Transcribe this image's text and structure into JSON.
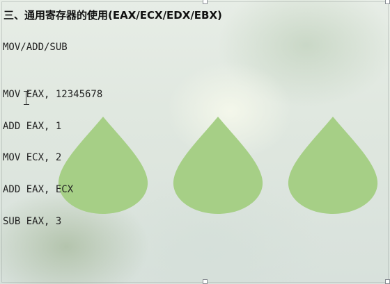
{
  "slide": {
    "title": "三、通用寄存器的使用(EAX/ECX/EDX/EBX)",
    "lines": [
      "MOV/ADD/SUB",
      "MOV EAX, 12345678",
      "ADD EAX, 1",
      "MOV ECX, 2",
      "ADD EAX, ECX",
      "SUB EAX, 3"
    ]
  },
  "decor": {
    "drop_color": "#a6cf86",
    "shapes": [
      "droplet",
      "droplet",
      "droplet"
    ]
  }
}
